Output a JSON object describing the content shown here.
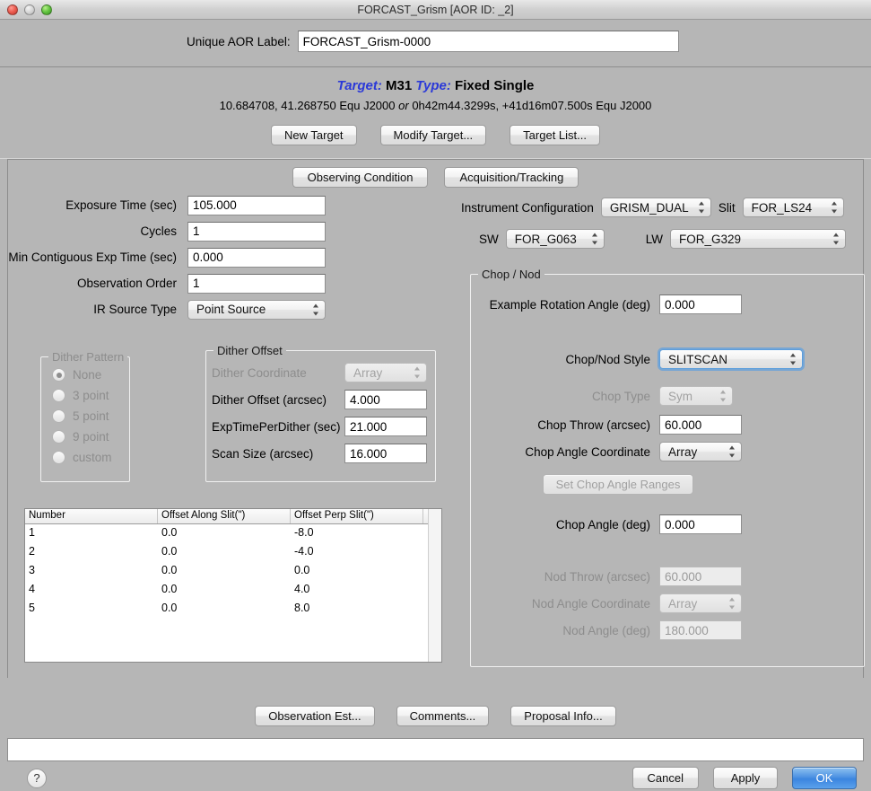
{
  "window": {
    "title": "FORCAST_Grism [AOR ID: _2]",
    "traffic_lights": [
      "close-red",
      "minimize-gray",
      "zoom-green"
    ]
  },
  "aor": {
    "label_text": "Unique AOR Label:",
    "value": "FORCAST_Grism-0000",
    "placeholder": ""
  },
  "target": {
    "target_kw": "Target:",
    "target_name": "M31",
    "type_kw": "Type:",
    "type_value": "Fixed Single",
    "coords_decimal": "10.684708, 41.268750  Equ J2000",
    "or_word": "or",
    "coords_sexagesimal": "0h42m44.3299s, +41d16m07.500s  Equ J2000",
    "buttons": [
      "New Target",
      "Modify Target...",
      "Target List..."
    ]
  },
  "tabs": [
    {
      "label": "Observing Condition"
    },
    {
      "label": "Acquisition/Tracking"
    }
  ],
  "observing": {
    "fields": [
      {
        "label": "Exposure Time (sec)",
        "value": "105.000"
      },
      {
        "label": "Cycles",
        "value": "1"
      },
      {
        "label": "Min Contiguous Exp Time (sec)",
        "value": "0.000"
      },
      {
        "label": "Observation Order",
        "value": "1"
      }
    ],
    "ir_source_type": {
      "label": "IR Source Type",
      "value": "Point Source"
    }
  },
  "instrument": {
    "config_label": "Instrument Configuration",
    "config_value": "GRISM_DUAL",
    "slit_label": "Slit",
    "slit_value": "FOR_LS24",
    "sw_label": "SW",
    "sw_value": "FOR_G063",
    "lw_label": "LW",
    "lw_value": "FOR_G329"
  },
  "dither_pattern": {
    "title": "Dither Pattern",
    "options": [
      {
        "label": "None",
        "selected": true,
        "disabled": true
      },
      {
        "label": "3 point",
        "selected": false,
        "disabled": true
      },
      {
        "label": "5 point",
        "selected": false,
        "disabled": true
      },
      {
        "label": "9 point",
        "selected": false,
        "disabled": true
      },
      {
        "label": "custom",
        "selected": false,
        "disabled": true
      }
    ]
  },
  "dither_offset": {
    "title": "Dither Offset",
    "coordinate_label": "Dither Coordinate",
    "coordinate_value": "Array",
    "fields": [
      {
        "label": "Dither Offset (arcsec)",
        "value": "4.000"
      },
      {
        "label": "ExpTimePerDither (sec)",
        "value": "21.000"
      },
      {
        "label": "Scan Size (arcsec)",
        "value": "16.000"
      }
    ]
  },
  "offset_table": {
    "columns": [
      "Number",
      "Offset Along Slit(\")",
      "Offset Perp Slit(\")"
    ],
    "rows": [
      [
        "1",
        "0.0",
        "-8.0"
      ],
      [
        "2",
        "0.0",
        "-4.0"
      ],
      [
        "3",
        "0.0",
        "0.0"
      ],
      [
        "4",
        "0.0",
        "4.0"
      ],
      [
        "5",
        "0.0",
        "8.0"
      ]
    ]
  },
  "chop_nod": {
    "title": "Chop / Nod",
    "rotation_angle": {
      "label": "Example Rotation Angle (deg)",
      "value": "0.000"
    },
    "style": {
      "label": "Chop/Nod Style",
      "value": "SLITSCAN",
      "focused": true
    },
    "chop_type": {
      "label": "Chop Type",
      "value": "Sym"
    },
    "chop_throw": {
      "label": "Chop Throw (arcsec)",
      "value": "60.000"
    },
    "chop_angle_coordinate": {
      "label": "Chop Angle Coordinate",
      "value": "Array"
    },
    "set_ranges_button": "Set Chop Angle Ranges",
    "chop_angle": {
      "label": "Chop Angle (deg)",
      "value": "0.000"
    },
    "nod_throw": {
      "label": "Nod Throw (arcsec)",
      "value": "60.000"
    },
    "nod_angle_coordinate": {
      "label": "Nod Angle Coordinate",
      "value": "Array"
    },
    "nod_angle": {
      "label": "Nod Angle (deg)",
      "value": "180.000"
    }
  },
  "bottom_actions": [
    "Observation Est...",
    "Comments...",
    "Proposal Info..."
  ],
  "status_bar": {
    "text": ""
  },
  "footer": {
    "help": "?",
    "cancel": "Cancel",
    "apply": "Apply",
    "ok": "OK"
  },
  "colors": {
    "window_bg": "#b6b6b6",
    "accent_blue": "#2b39d8",
    "default_button": "#3b85df",
    "focus_ring": "#5b9ddc"
  }
}
